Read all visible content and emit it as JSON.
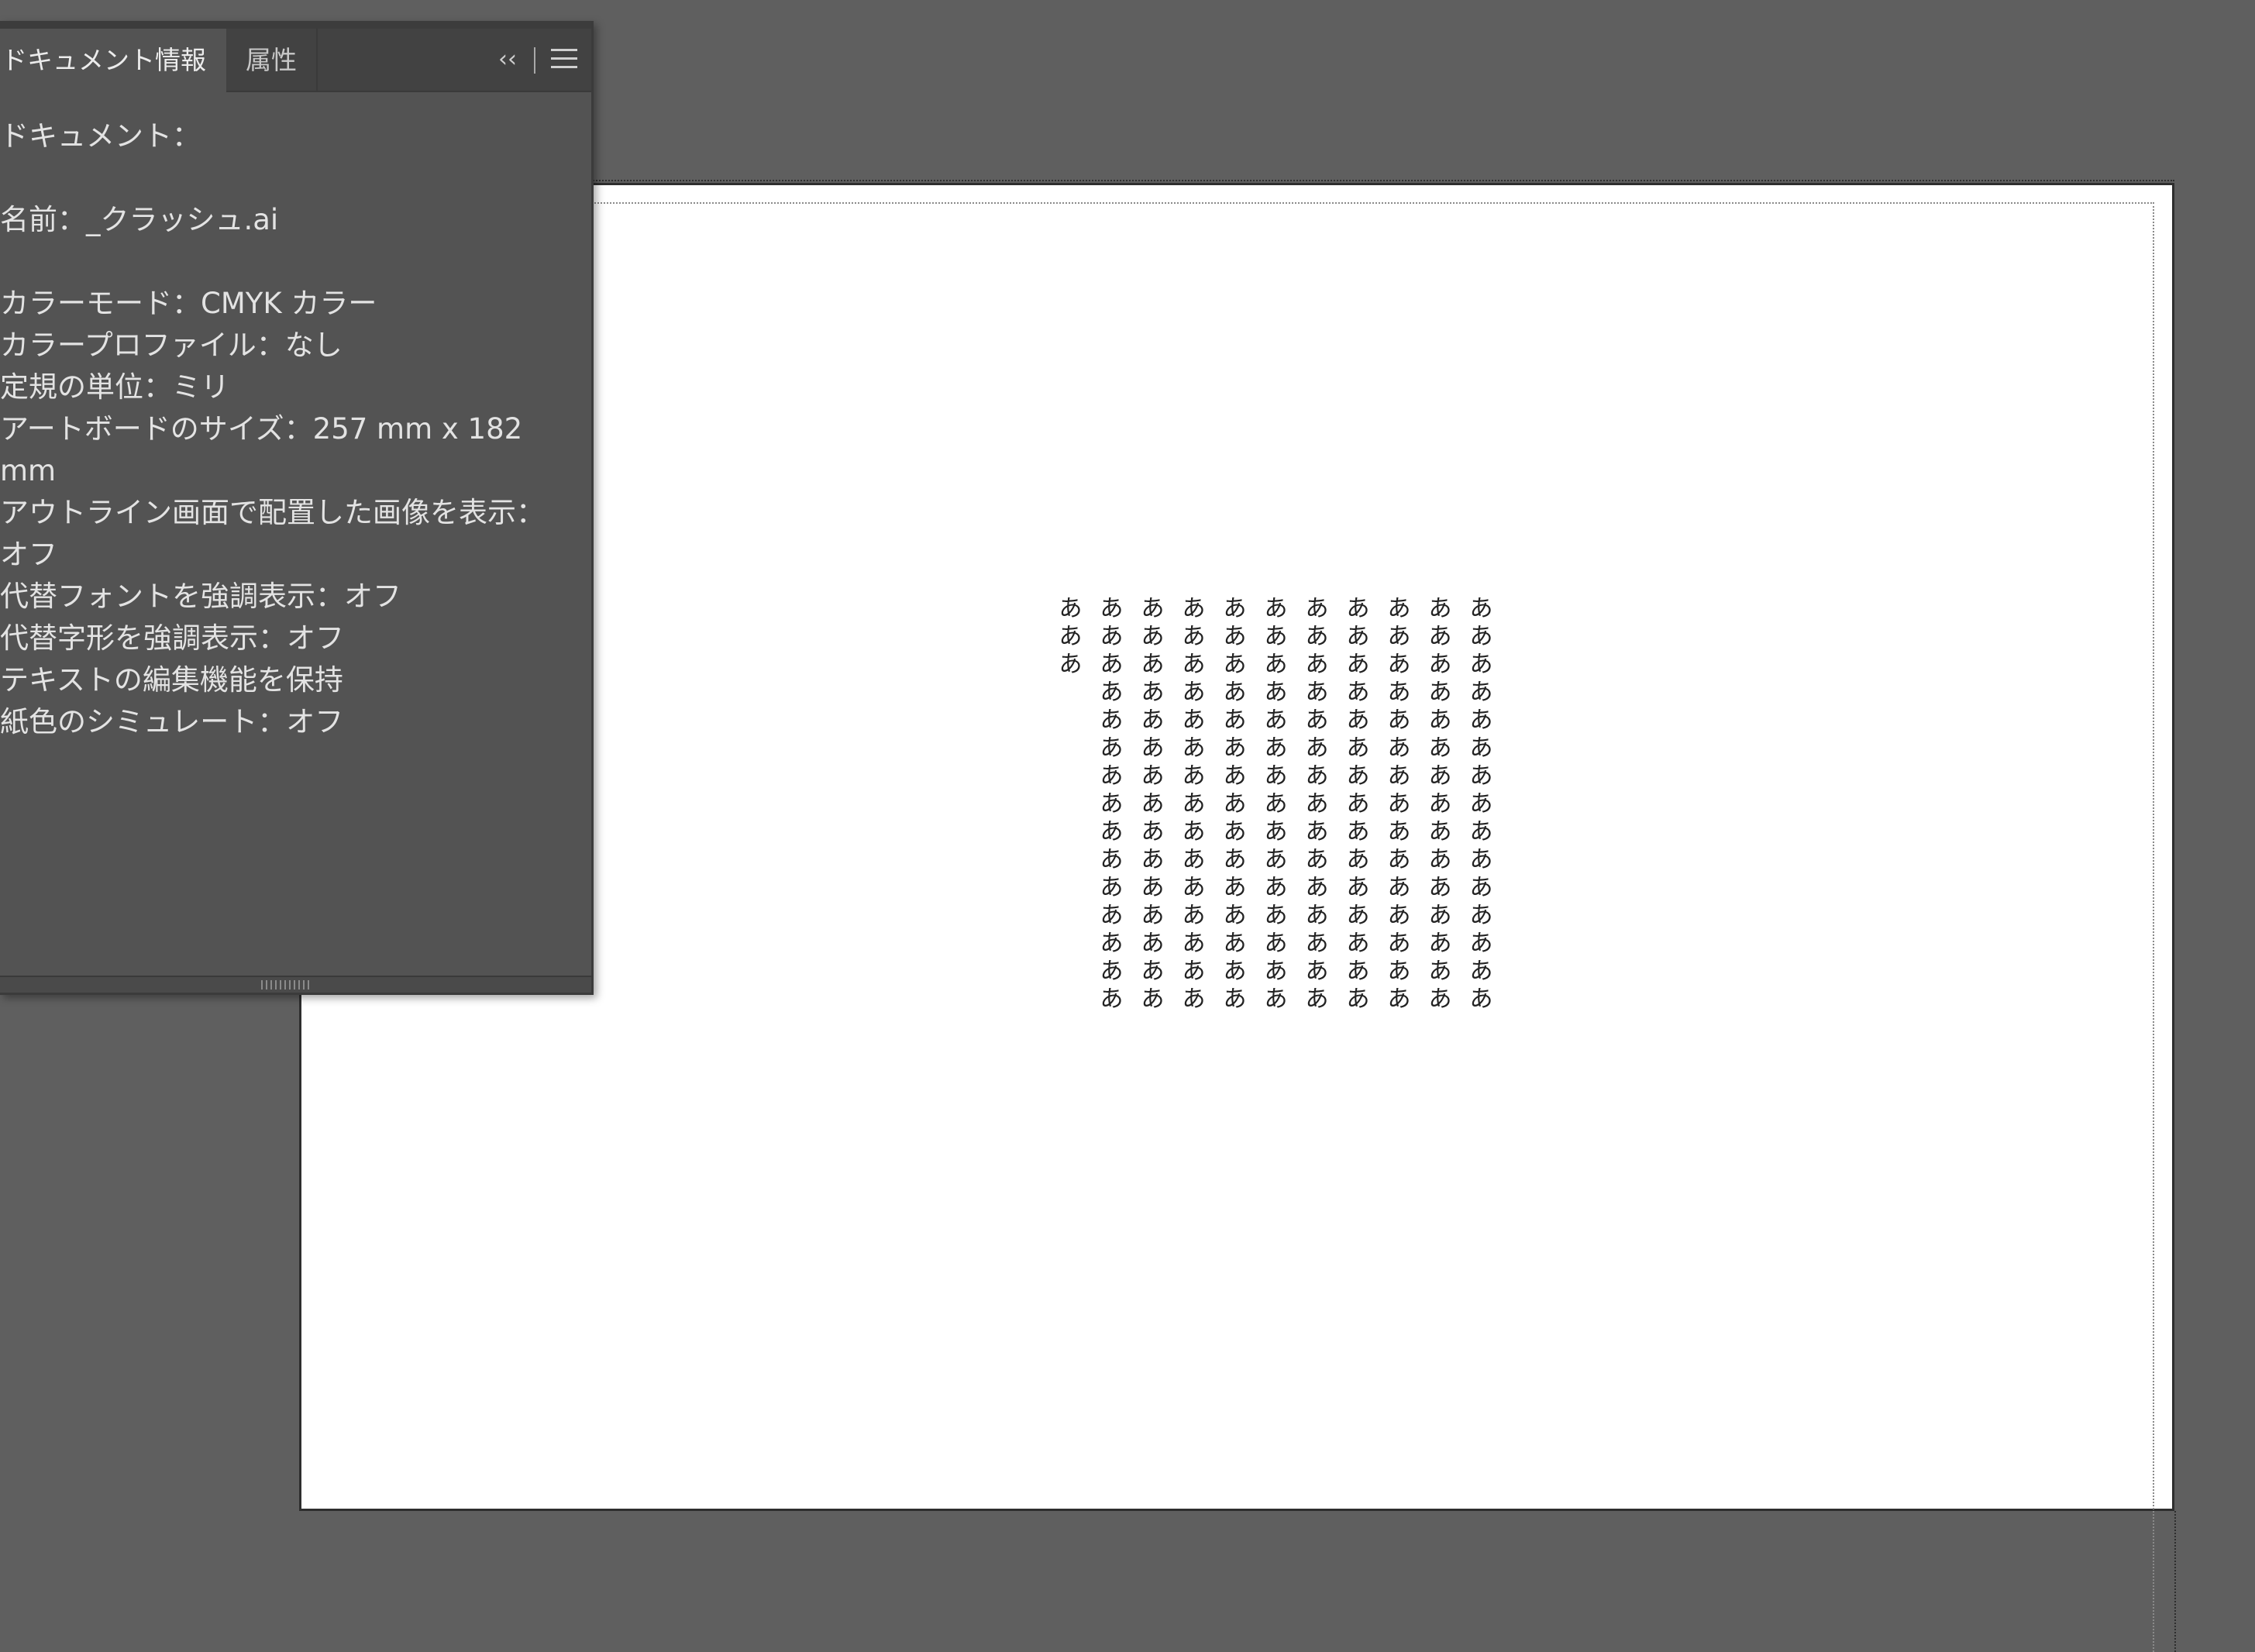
{
  "panel": {
    "tabs": [
      {
        "label": "ドキュメント情報",
        "active": true
      },
      {
        "label": "属性",
        "active": false
      }
    ],
    "collapse_icon": "double-chevron-left-icon",
    "menu_icon": "hamburger-menu-icon",
    "lines": [
      "ドキュメント：",
      "",
      "名前：_クラッシュ.ai",
      "",
      "カラーモード：CMYK カラー",
      "カラープロファイル：なし",
      "定規の単位：ミリ",
      "アートボードのサイズ：257 mm x 182",
      "mm",
      "アウトライン画面で配置した画像を表示：",
      "オフ",
      "代替フォントを強調表示：オフ",
      "代替字形を強調表示：オフ",
      "テキストの編集機能を保持",
      "紙色のシミュレート：オフ"
    ]
  },
  "canvas": {
    "text_glyph": "あ",
    "columns": [
      15,
      15,
      15,
      15,
      15,
      15,
      15,
      15,
      15,
      15,
      3
    ]
  },
  "colors": {
    "pasteboard": "#5f5f5f",
    "panel_bg": "#535353",
    "artboard": "#ffffff"
  }
}
